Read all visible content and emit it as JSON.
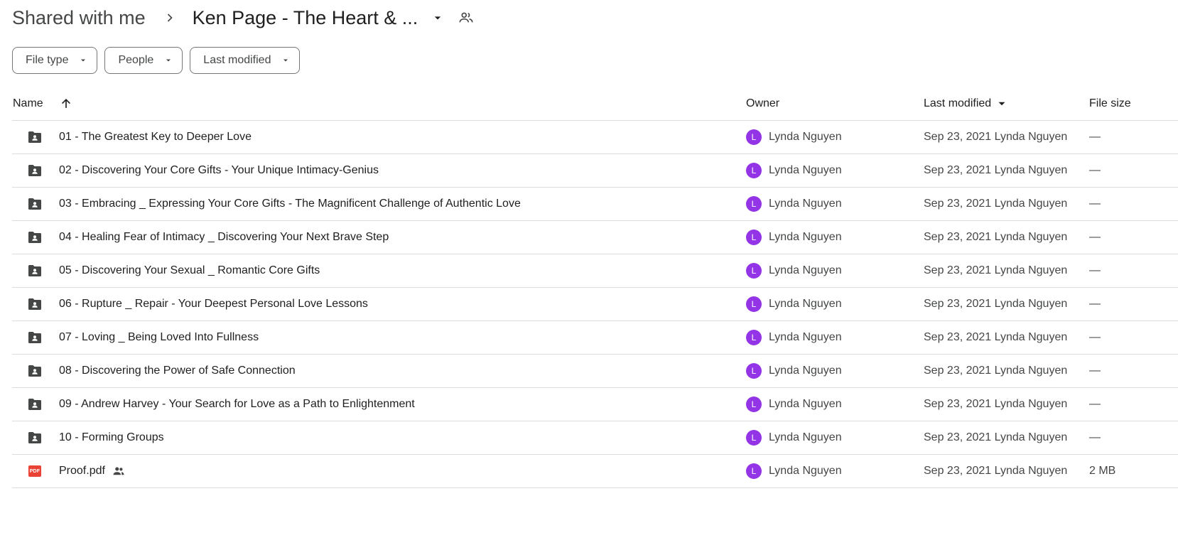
{
  "breadcrumb": {
    "root": "Shared with me",
    "current": "Ken Page - The Heart & ..."
  },
  "filters": [
    {
      "label": "File type"
    },
    {
      "label": "People"
    },
    {
      "label": "Last modified"
    }
  ],
  "table": {
    "headers": {
      "name": "Name",
      "owner": "Owner",
      "last_modified": "Last modified",
      "file_size": "File size"
    },
    "rows": [
      {
        "type": "shared-folder",
        "name": "01 -  The Greatest Key to Deeper Love",
        "owner_initial": "L",
        "owner": "Lynda Nguyen",
        "modified": "Sep 23, 2021 Lynda Nguyen",
        "size": "—"
      },
      {
        "type": "shared-folder",
        "name": "02 -  Discovering Your Core Gifts - Your Unique Intimacy-Genius",
        "owner_initial": "L",
        "owner": "Lynda Nguyen",
        "modified": "Sep 23, 2021 Lynda Nguyen",
        "size": "—"
      },
      {
        "type": "shared-folder",
        "name": "03 -  Embracing _ Expressing Your Core Gifts - The Magnificent Challenge of Authentic Love",
        "owner_initial": "L",
        "owner": "Lynda Nguyen",
        "modified": "Sep 23, 2021 Lynda Nguyen",
        "size": "—"
      },
      {
        "type": "shared-folder",
        "name": "04 -  Healing Fear of Intimacy _ Discovering Your Next Brave Step",
        "owner_initial": "L",
        "owner": "Lynda Nguyen",
        "modified": "Sep 23, 2021 Lynda Nguyen",
        "size": "—"
      },
      {
        "type": "shared-folder",
        "name": "05 -  Discovering Your Sexual _ Romantic Core Gifts",
        "owner_initial": "L",
        "owner": "Lynda Nguyen",
        "modified": "Sep 23, 2021 Lynda Nguyen",
        "size": "—"
      },
      {
        "type": "shared-folder",
        "name": "06 -  Rupture _ Repair - Your Deepest Personal Love Lessons",
        "owner_initial": "L",
        "owner": "Lynda Nguyen",
        "modified": "Sep 23, 2021 Lynda Nguyen",
        "size": "—"
      },
      {
        "type": "shared-folder",
        "name": "07 -  Loving _ Being Loved Into Fullness",
        "owner_initial": "L",
        "owner": "Lynda Nguyen",
        "modified": "Sep 23, 2021 Lynda Nguyen",
        "size": "—"
      },
      {
        "type": "shared-folder",
        "name": "08 -  Discovering the Power of Safe Connection",
        "owner_initial": "L",
        "owner": "Lynda Nguyen",
        "modified": "Sep 23, 2021 Lynda Nguyen",
        "size": "—"
      },
      {
        "type": "shared-folder",
        "name": "09 - Andrew Harvey - Your Search for Love as a Path to Enlightenment",
        "owner_initial": "L",
        "owner": "Lynda Nguyen",
        "modified": "Sep 23, 2021 Lynda Nguyen",
        "size": "—"
      },
      {
        "type": "shared-folder",
        "name": "10 - Forming Groups",
        "owner_initial": "L",
        "owner": "Lynda Nguyen",
        "modified": "Sep 23, 2021 Lynda Nguyen",
        "size": "—"
      },
      {
        "type": "pdf",
        "name": "Proof.pdf",
        "badge": "PDF",
        "shared": true,
        "owner_initial": "L",
        "owner": "Lynda Nguyen",
        "modified": "Sep 23, 2021 Lynda Nguyen",
        "size": "2 MB"
      }
    ]
  },
  "icons": {
    "folder": "shared-folder-icon",
    "pdf": "pdf-icon",
    "shared": "people-icon",
    "separator": "chevron-right-icon",
    "dropdown": "arrow-drop-down-icon",
    "sort": "arrow-up-icon"
  },
  "colors": {
    "avatar": "#9334e6",
    "pdf": "#ea4335",
    "folder": "#444746"
  }
}
